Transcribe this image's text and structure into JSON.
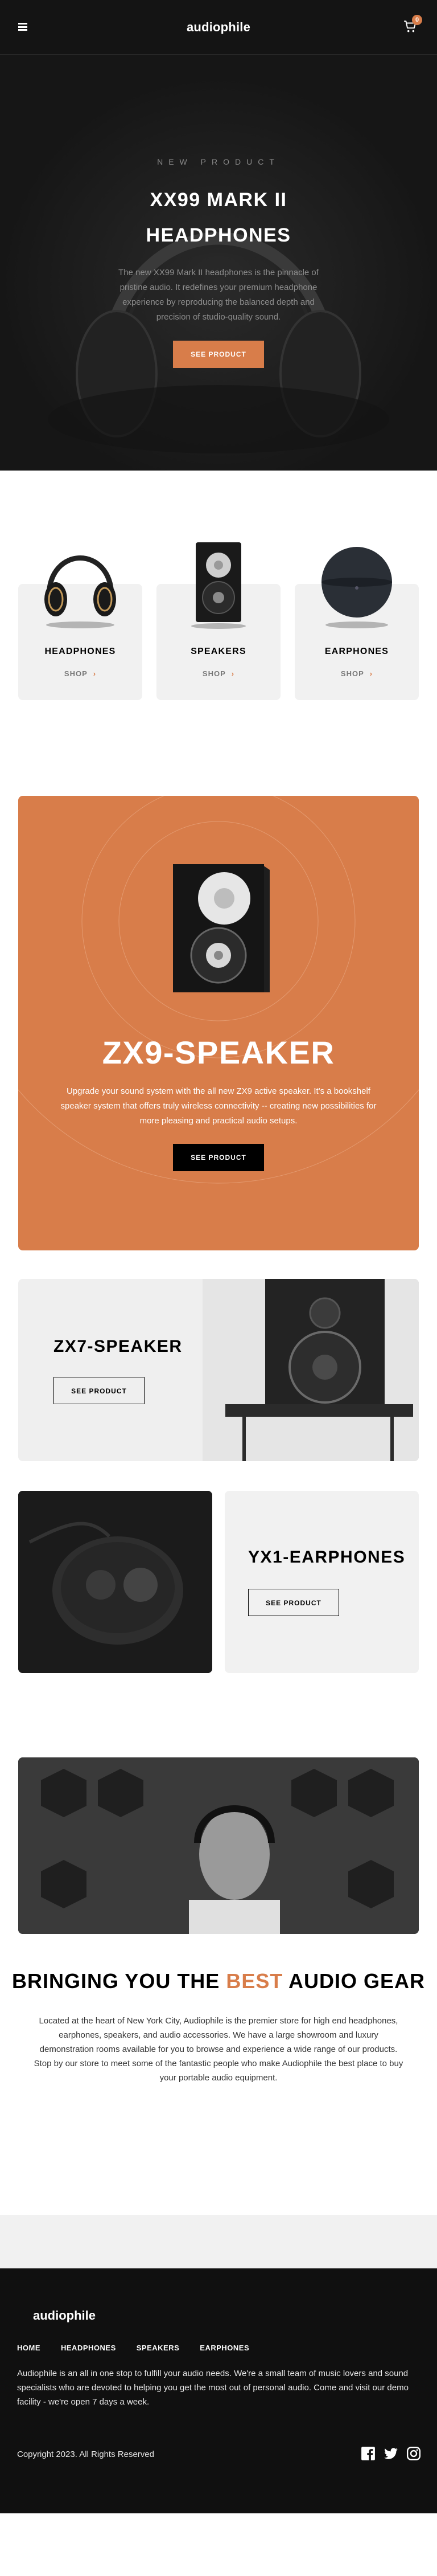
{
  "header": {
    "logo": "audiophile",
    "cart_count": "0"
  },
  "hero": {
    "overline": "NEW PRODUCT",
    "title_line1": "XX99 MARK II",
    "title_line2": "HEADPHONES",
    "description": "The new XX99 Mark II headphones is the pinnacle of pristine audio. It redefines your premium headphone experience by reproducing the balanced depth and precision of studio-quality sound.",
    "button": "SEE PRODUCT"
  },
  "categories": [
    {
      "title": "HEADPHONES",
      "shop": "SHOP"
    },
    {
      "title": "SPEAKERS",
      "shop": "SHOP"
    },
    {
      "title": "EARPHONES",
      "shop": "SHOP"
    }
  ],
  "zx9": {
    "title": "ZX9-SPEAKER",
    "description": "Upgrade your sound system with the all new ZX9 active speaker. It's a bookshelf speaker system that offers truly wireless connectivity -- creating new possibilities for more pleasing and practical audio setups.",
    "button": "SEE PRODUCT"
  },
  "zx7": {
    "title": "ZX7-SPEAKER",
    "button": "SEE PRODUCT"
  },
  "yx1": {
    "title": "YX1-EARPHONES",
    "button": "SEE PRODUCT"
  },
  "about": {
    "title_pre": "BRINGING YOU THE ",
    "title_accent": "BEST",
    "title_post": " AUDIO GEAR",
    "description": "Located at the heart of New York City, Audiophile is the premier store for high end headphones, earphones, speakers, and audio accessories. We have a large showroom and luxury demonstration rooms available for you to browse and experience a wide range of our products. Stop by our store to meet some of the fantastic people who make Audiophile the best place to buy your portable audio equipment."
  },
  "footer": {
    "logo": "audiophile",
    "nav": [
      "HOME",
      "HEADPHONES",
      "SPEAKERS",
      "EARPHONES"
    ],
    "description": "Audiophile is an all in one stop to fulfill your audio needs. We're a small team of music lovers and sound specialists who are devoted to helping you get the most out of personal audio. Come and visit our demo facility - we're open 7 days a week.",
    "copyright": "Copyright 2023. All Rights Reserved"
  },
  "colors": {
    "accent": "#d87d4a",
    "dark": "#141414",
    "light_gray": "#f1f1f1"
  }
}
